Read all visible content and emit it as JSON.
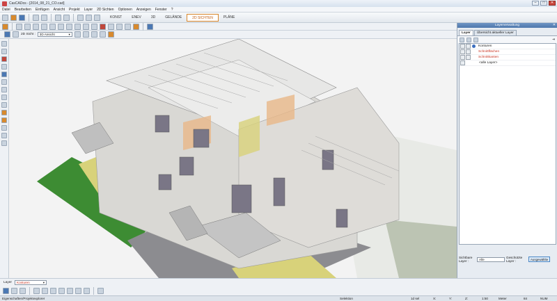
{
  "window": {
    "title": "CasCADos - [2014_08_21_CO.cad]",
    "min": "–",
    "max": "□",
    "close": "✕"
  },
  "menu": [
    "Datei",
    "Bearbeiten",
    "Einfügen",
    "Ansicht",
    "Projekt",
    "Layer",
    "2D Sichten",
    "Optionen",
    "Anzeigen",
    "Fenster",
    "?"
  ],
  "view_tabs": [
    {
      "label": "KONST",
      "active": false
    },
    {
      "label": "ENEV",
      "active": false
    },
    {
      "label": "3D",
      "active": false
    },
    {
      "label": "GELÄNDE",
      "active": false
    },
    {
      "label": "2D SICHTEN",
      "active": true
    },
    {
      "label": "PLÄNE",
      "active": false
    }
  ],
  "view_select": {
    "label": "2D Sicht :",
    "value": "3D Ansicht",
    "arrow": "▾"
  },
  "layer_panel": {
    "title": "Layerverwaltung",
    "close": "✕",
    "tabs": [
      {
        "label": "Layer",
        "active": true
      },
      {
        "label": "Übersicht aktueller Layer",
        "active": false
      }
    ],
    "pin": "⇥",
    "layers": [
      {
        "name": "Konturen",
        "red": false,
        "active": true
      },
      {
        "name": "Schnittflächen",
        "red": true,
        "active": false
      },
      {
        "name": "Schnittkanten",
        "red": true,
        "active": false
      },
      {
        "name": "<alle Layer>",
        "red": false,
        "active": false
      }
    ],
    "visible_label": "Sichtbare Layer :",
    "visible_value": "Alle",
    "protected_label": "Geschützte Layer :",
    "selected_button": "Ausgewählte"
  },
  "bottom": {
    "layer_label": "Layer",
    "layer_value": "Konturen",
    "arrow": "▾"
  },
  "status": {
    "left": "Eigenschaften/Projektexplorer",
    "mode": "Selektion",
    "sel": "1d sel",
    "x": "X:",
    "y": "Y:",
    "z": "Z:",
    "scale": "1:50",
    "unit": "Meter",
    "n": "84",
    "num": "NUM"
  },
  "colors": {
    "accent": "#d8862a",
    "panel_header": "#4e78ad",
    "lawn": "#3d8c33",
    "terrace": "#d8d27a"
  }
}
